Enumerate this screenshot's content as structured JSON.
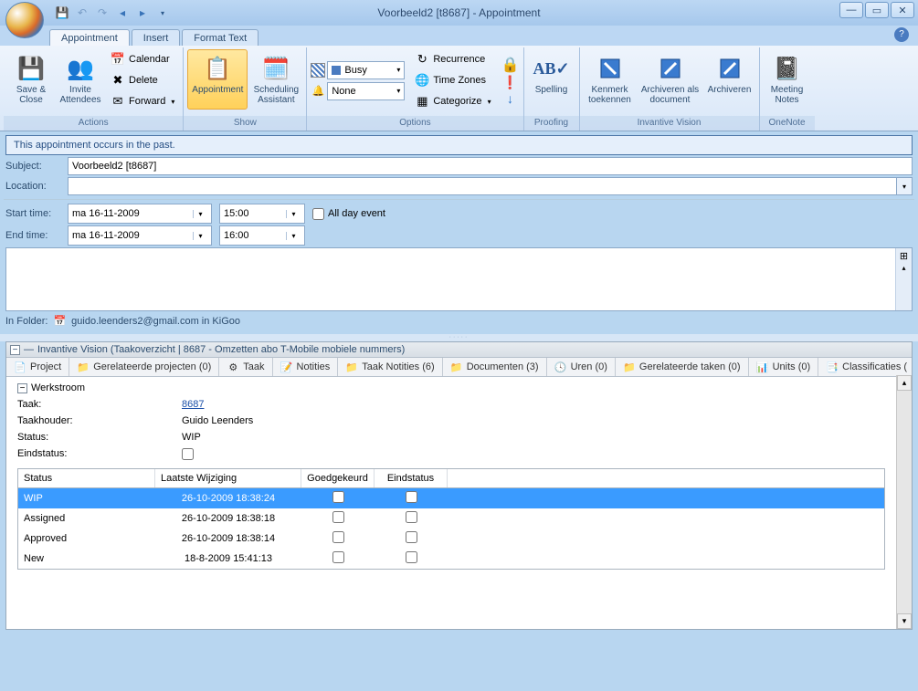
{
  "window": {
    "title": "Voorbeeld2 [t8687] - Appointment"
  },
  "tabs": {
    "appointment": "Appointment",
    "insert": "Insert",
    "format": "Format Text"
  },
  "ribbon": {
    "actions": {
      "label": "Actions",
      "save_close": "Save & Close",
      "invite": "Invite Attendees",
      "calendar": "Calendar",
      "delete": "Delete",
      "forward": "Forward"
    },
    "show": {
      "label": "Show",
      "appointment": "Appointment",
      "scheduling": "Scheduling Assistant"
    },
    "options": {
      "label": "Options",
      "busy": "Busy",
      "none": "None",
      "recurrence": "Recurrence",
      "timezones": "Time Zones",
      "categorize": "Categorize"
    },
    "proofing": {
      "label": "Proofing",
      "spelling": "Spelling"
    },
    "invantive": {
      "label": "Invantive Vision",
      "kenmerk": "Kenmerk toekennen",
      "arch_doc": "Archiveren als document",
      "arch": "Archiveren"
    },
    "onenote": {
      "label": "OneNote",
      "meeting": "Meeting Notes"
    }
  },
  "notice": "This appointment occurs in the past.",
  "form": {
    "subject_lbl": "Subject:",
    "subject_val": "Voorbeeld2 [t8687]",
    "location_lbl": "Location:",
    "location_val": "",
    "start_lbl": "Start time:",
    "start_date": "ma 16-11-2009",
    "start_time": "15:00",
    "end_lbl": "End time:",
    "end_date": "ma 16-11-2009",
    "end_time": "16:00",
    "allday": "All day event",
    "infolder_lbl": "In Folder:",
    "infolder_val": "guido.leenders2@gmail.com in KiGoo"
  },
  "panel": {
    "title": "Invantive Vision (Taakoverzicht | 8687 - Omzetten abo T-Mobile mobiele nummers)",
    "subtabs": {
      "project": "Project",
      "gerel_proj": "Gerelateerde projecten (0)",
      "taak": "Taak",
      "notities": "Notities",
      "taak_not": "Taak Notities (6)",
      "documenten": "Documenten (3)",
      "uren": "Uren (0)",
      "gerel_taken": "Gerelateerde taken (0)",
      "units": "Units (0)",
      "class": "Classificaties ("
    },
    "section": "Werkstroom",
    "fields": {
      "taak_lbl": "Taak:",
      "taak_val": "8687",
      "taakhouder_lbl": "Taakhouder:",
      "taakhouder_val": "Guido Leenders",
      "status_lbl": "Status:",
      "status_val": "WIP",
      "eind_lbl": "Eindstatus:"
    },
    "table": {
      "headers": {
        "status": "Status",
        "laatste": "Laatste Wijziging",
        "goed": "Goedgekeurd",
        "eind": "Eindstatus"
      },
      "rows": [
        {
          "status": "WIP",
          "date": "26-10-2009 18:38:24"
        },
        {
          "status": "Assigned",
          "date": "26-10-2009 18:38:18"
        },
        {
          "status": "Approved",
          "date": "26-10-2009 18:38:14"
        },
        {
          "status": "New",
          "date": "18-8-2009 15:41:13"
        }
      ]
    }
  }
}
